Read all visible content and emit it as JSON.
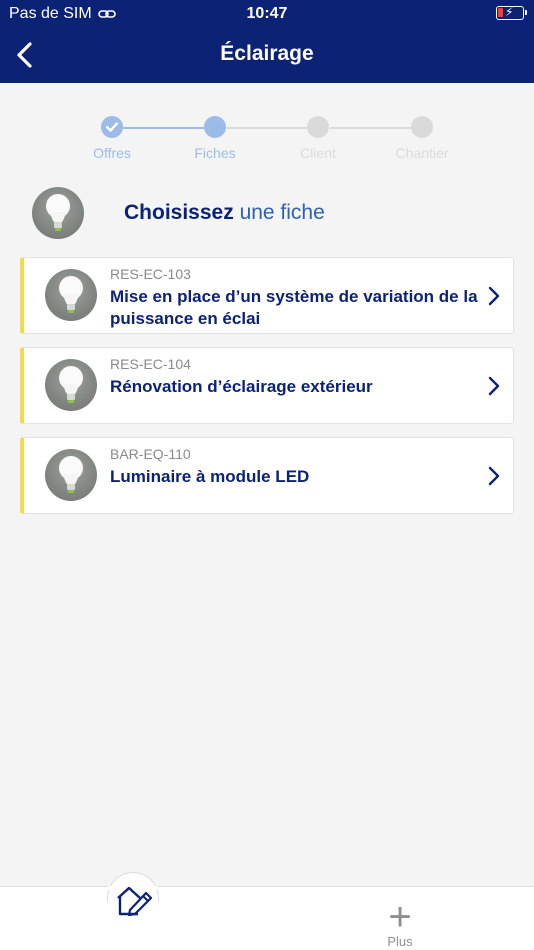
{
  "status": {
    "carrier": "Pas de SIM",
    "time": "10:47"
  },
  "nav": {
    "title": "Éclairage"
  },
  "stepper": {
    "steps": [
      {
        "label": "Offres",
        "state": "done"
      },
      {
        "label": "Fiches",
        "state": "current"
      },
      {
        "label": "Client",
        "state": "pending"
      },
      {
        "label": "Chantier",
        "state": "pending"
      }
    ]
  },
  "header": {
    "prefix": "Choisissez",
    "accent": "une fiche"
  },
  "cards": [
    {
      "code": "RES-EC-103",
      "title": "Mise en place d’un système de variation de la puissance en éclai"
    },
    {
      "code": "RES-EC-104",
      "title": "Rénovation d’éclairage extérieur"
    },
    {
      "code": "BAR-EQ-110",
      "title": "Luminaire à module LED"
    }
  ],
  "tabbar": {
    "plus_label": "Plus"
  },
  "colors": {
    "primary": "#0c2375",
    "accent": "#2e60b8",
    "step_active": "#9cbbe6",
    "step_inactive": "#dadada",
    "card_stripe": "#f3da4a"
  }
}
